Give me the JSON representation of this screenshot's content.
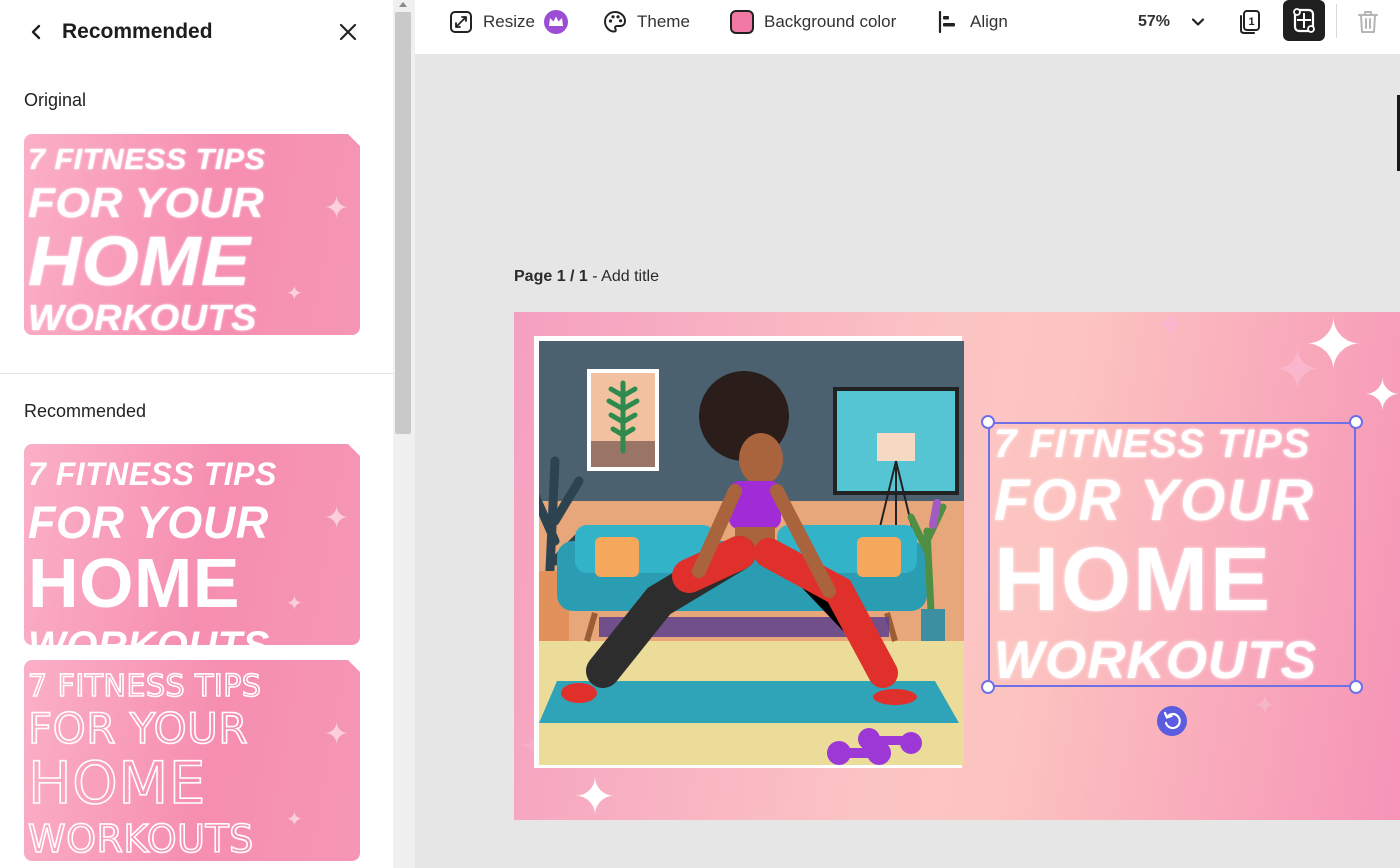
{
  "panel": {
    "title": "Recommended",
    "back_icon": "chevron-left-icon",
    "close_icon": "close-icon",
    "original_label": "Original",
    "recommended_label": "Recommended",
    "thumb_text": {
      "line1": "7 FITNESS TIPS",
      "line2": "FOR YOUR",
      "line3": "HOME",
      "line4": "WORKOUTS"
    }
  },
  "toolbar": {
    "resize_label": "Resize",
    "theme_label": "Theme",
    "background_color_label": "Background color",
    "align_label": "Align",
    "zoom_label": "57%",
    "background_color_swatch": "#f07aa3",
    "premium_badge_color": "#9b4dd6"
  },
  "canvas": {
    "page_label": "Page 1 / 1",
    "page_title_prompt": "- Add title",
    "title_lines": [
      "7 FITNESS TIPS",
      "FOR YOUR",
      "HOME",
      "WORKOUTS"
    ],
    "selection_color": "#6f70e8"
  }
}
